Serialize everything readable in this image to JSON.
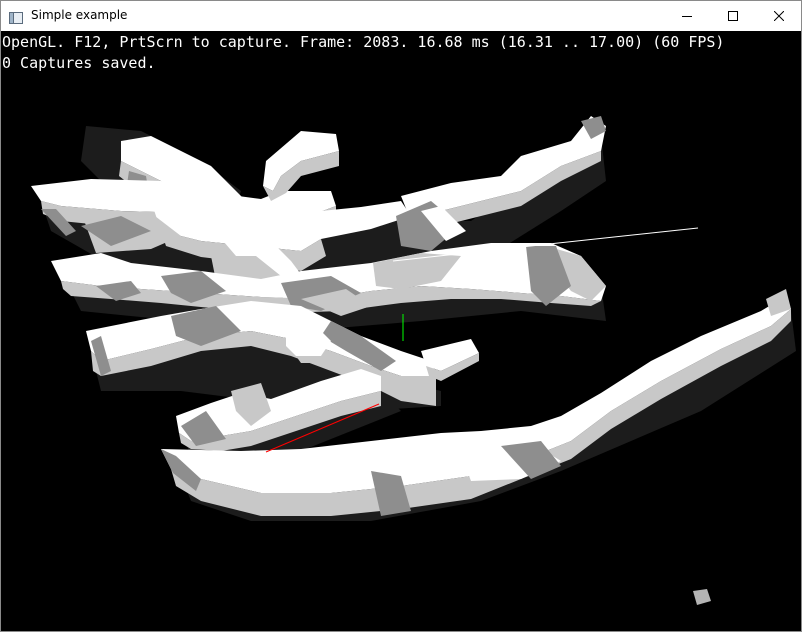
{
  "window": {
    "title": "Simple example",
    "minimize_icon": "minimize-icon",
    "maximize_icon": "maximize-icon",
    "close_icon": "close-icon",
    "app_icon": "app-window-icon"
  },
  "hud": {
    "line1": "OpenGL. F12, PrtScrn to capture. Frame: 2083. 16.68 ms (16.31 .. 17.00) (60 FPS)",
    "line2": "0 Captures saved."
  },
  "colors": {
    "background": "#000000",
    "face_light": "#ffffff",
    "face_mid": "#c8c8c8",
    "face_dark": "#8e8e8e",
    "shadow": "#1c1c1c",
    "axis_x": "#ff0000",
    "axis_y": "#00ff00",
    "axis_z": "#ffffff"
  }
}
